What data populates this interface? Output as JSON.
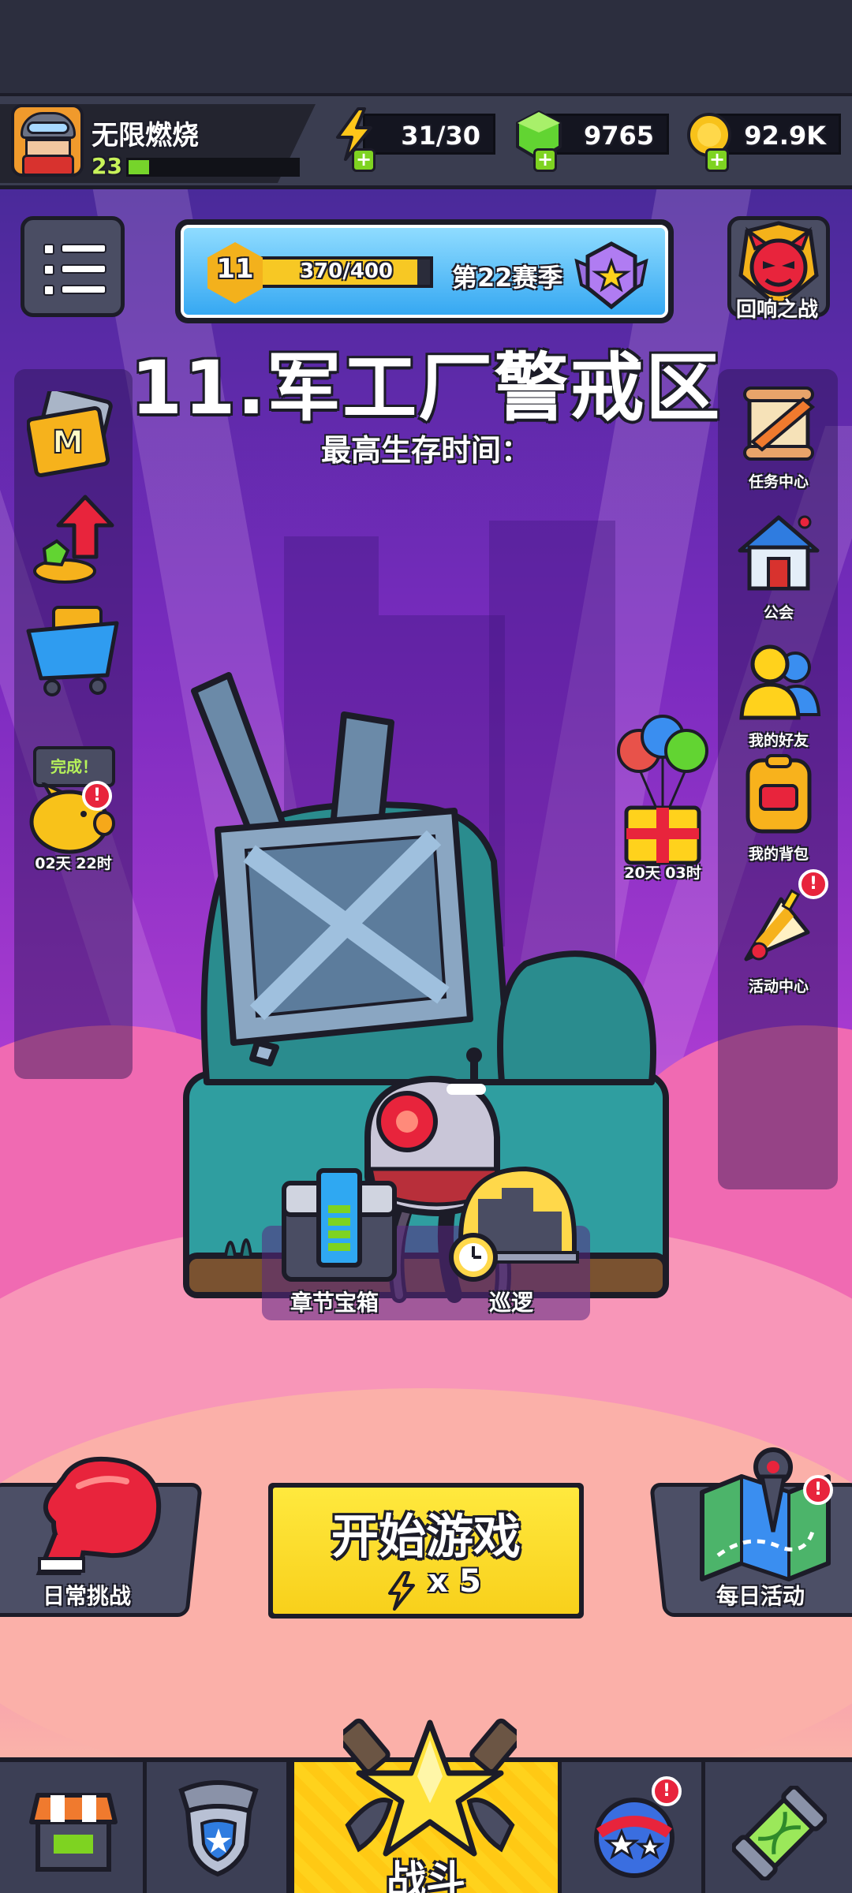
{
  "player": {
    "name": "无限燃烧",
    "level": "23",
    "xp_fraction": 0.12
  },
  "resources": {
    "energy": "31/30",
    "gems": "9765",
    "coins": "92.9K"
  },
  "season": {
    "level": "11",
    "progress": "370/400",
    "progress_fraction": 0.925,
    "label": "第22赛季"
  },
  "boss": {
    "label": "回响之战"
  },
  "stage": {
    "title": "11.军工厂警戒区",
    "survival_time_label": "最高生存时间："
  },
  "left_side": {
    "piggy_badge": "完成！",
    "piggy_timer": "02天 22时"
  },
  "right_side": {
    "items": [
      "任务中心",
      "公会",
      "我的好友",
      "我的背包",
      "活动中心"
    ],
    "gift_timer": "20天 03时"
  },
  "chapter": {
    "chest_label": "章节宝箱",
    "patrol_label": "巡逻"
  },
  "actions": {
    "daily_challenge": "日常挑战",
    "start_game": "开始游戏",
    "start_cost": "x 5",
    "daily_activity": "每日活动"
  },
  "nav": {
    "battle_label": "战斗",
    "alert": "!"
  },
  "colors": {
    "accent_yellow": "#ffd21c",
    "badge_red": "#e8243c",
    "xp_green": "#76d42b",
    "season_blue": "#36a8f2"
  },
  "icons": [
    "menu-icon",
    "lightning-icon",
    "gem-icon",
    "coin-icon",
    "season-medal-icon",
    "boss-devil-icon",
    "card-m-icon",
    "upgrade-arrow-icon",
    "shopping-cart-icon",
    "piggy-bank-icon",
    "scroll-quill-icon",
    "guild-house-icon",
    "friends-icon",
    "backpack-icon",
    "party-horn-icon",
    "balloon-gift-icon",
    "chapter-chest-icon",
    "patrol-clock-icon",
    "boxing-glove-icon",
    "treasure-map-icon",
    "shop-stall-icon",
    "shield-badge-icon",
    "star-swords-icon",
    "star-ball-icon",
    "dna-capsule-icon"
  ]
}
